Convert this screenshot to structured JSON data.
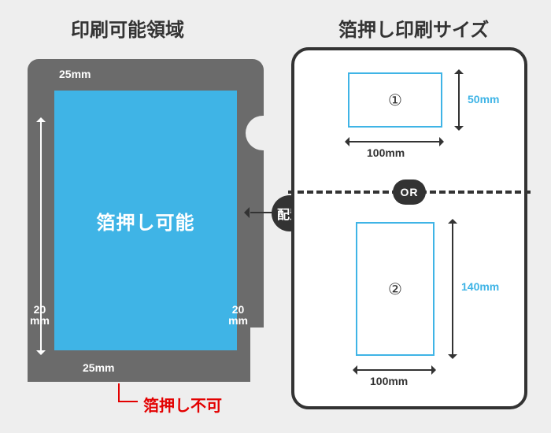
{
  "titles": {
    "left": "印刷可能領域",
    "right": "箔押し印刷サイズ"
  },
  "folder": {
    "printable_label": "箔押し可能",
    "margins": {
      "top": "25mm",
      "bottom": "25mm",
      "left_line1": "20",
      "left_line2": "mm",
      "right_line1": "20",
      "right_line2": "mm"
    },
    "callout": "箔押し不可"
  },
  "connector": {
    "label": "配置"
  },
  "card": {
    "or_label": "OR",
    "option1": {
      "id": "①",
      "width": "100mm",
      "height": "50mm"
    },
    "option2": {
      "id": "②",
      "width": "100mm",
      "height": "140mm"
    }
  }
}
